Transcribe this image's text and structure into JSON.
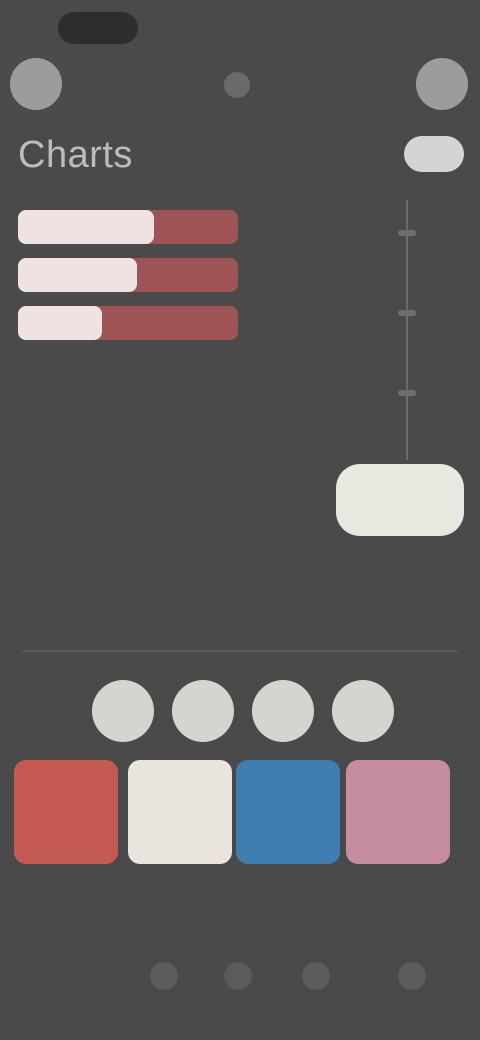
{
  "status_bar": {
    "time": ""
  },
  "header": {
    "left_button_icon": "circle-button-icon",
    "center_icon": "menu-icon",
    "right_button_icon": "profile-icon"
  },
  "main": {
    "title": "Charts",
    "bars": [
      {
        "level": 0.62
      },
      {
        "level": 0.54
      },
      {
        "level": 0.38
      }
    ],
    "bars_caption": "",
    "right_chip": {
      "text": ""
    },
    "cta_label": ""
  },
  "circles": [
    {
      "label": ""
    },
    {
      "label": ""
    },
    {
      "label": ""
    },
    {
      "label": ""
    }
  ],
  "swatches": [
    {
      "color": "#c55a52",
      "label": ""
    },
    {
      "color": "#ebe5df",
      "label": ""
    },
    {
      "color": "#3e7eb0",
      "label": ""
    },
    {
      "color": "#c68d9f",
      "label": ""
    }
  ],
  "bottom_nav": [
    {
      "icon": "home-icon"
    },
    {
      "icon": "search-icon"
    },
    {
      "icon": "chat-icon"
    },
    {
      "icon": "profile-icon"
    }
  ]
}
